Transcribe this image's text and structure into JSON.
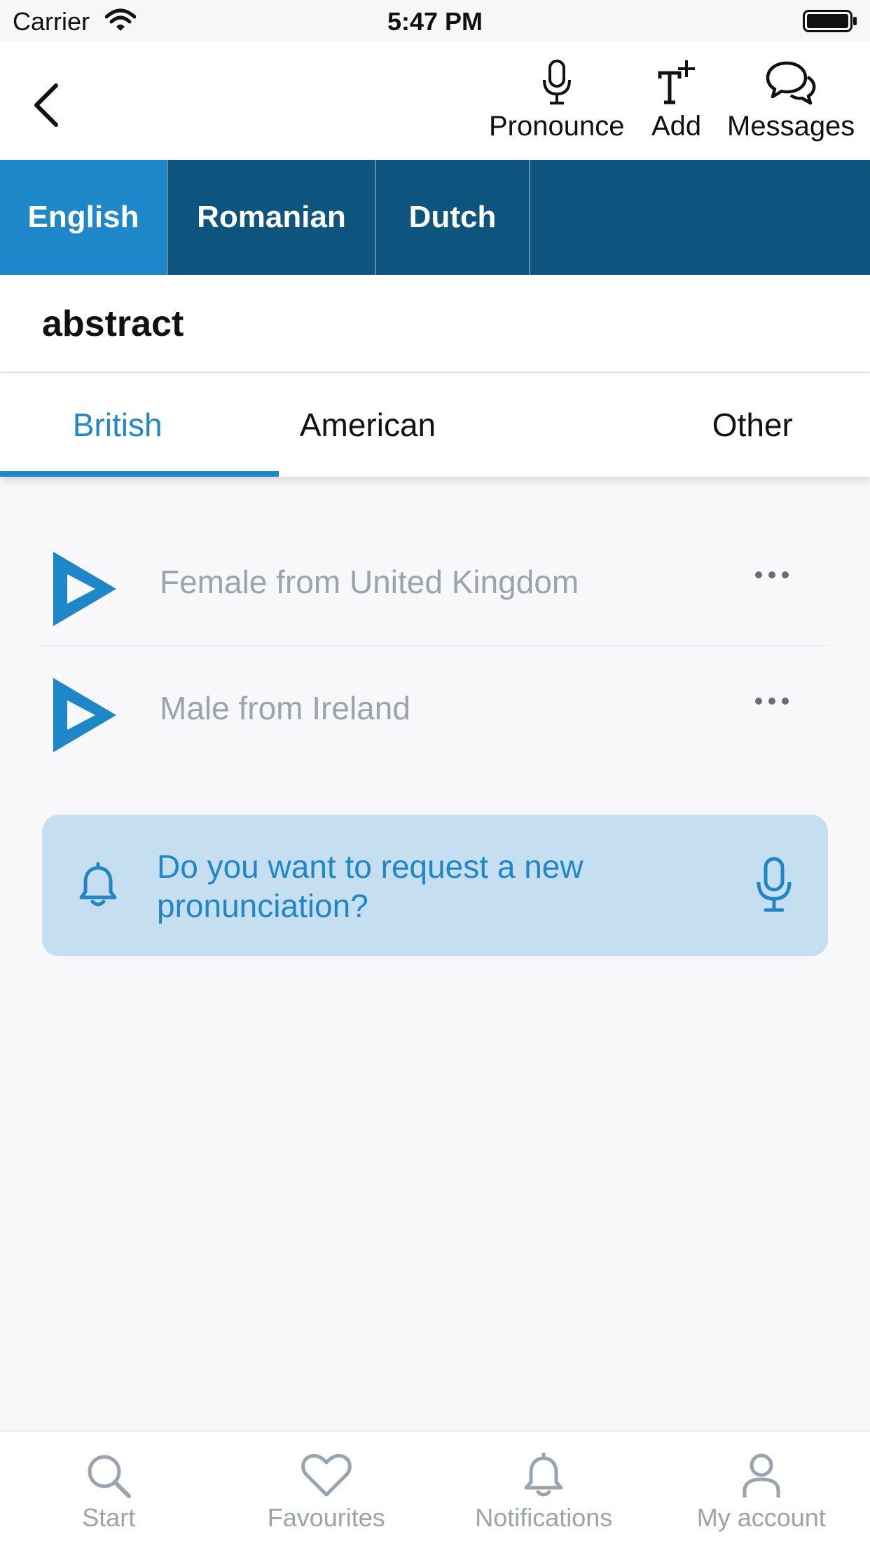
{
  "status_bar": {
    "carrier": "Carrier",
    "time": "5:47 PM"
  },
  "toolbar": {
    "back_icon": "chevron-left-icon",
    "actions": [
      {
        "label": "Pronounce",
        "icon": "microphone-icon"
      },
      {
        "label": "Add",
        "icon": "add-text-icon"
      },
      {
        "label": "Messages",
        "icon": "chat-bubbles-icon"
      }
    ]
  },
  "language_tabs": [
    {
      "label": "English",
      "active": true
    },
    {
      "label": "Romanian",
      "active": false
    },
    {
      "label": "Dutch",
      "active": false
    }
  ],
  "word": "abstract",
  "accent_tabs": [
    {
      "label": "British",
      "active": true
    },
    {
      "label": "American",
      "active": false
    },
    {
      "label": "Other",
      "active": false
    }
  ],
  "pronunciations": [
    {
      "label": "Female from United Kingdom",
      "icon": "play-icon"
    },
    {
      "label": "Male from Ireland",
      "icon": "play-icon"
    }
  ],
  "request_box": {
    "text": "Do you want to request a new pronunciation?",
    "left_icon": "bell-icon",
    "right_icon": "microphone-icon"
  },
  "bottom_tabs": [
    {
      "label": "Start",
      "icon": "search-icon"
    },
    {
      "label": "Favourites",
      "icon": "heart-icon"
    },
    {
      "label": "Notifications",
      "icon": "bell-icon"
    },
    {
      "label": "My account",
      "icon": "user-icon"
    }
  ],
  "colors": {
    "accent": "#1e87c9",
    "language_bar": "#0d557e",
    "request_bg": "#c5dff1",
    "muted_text": "#9aa4ae"
  }
}
